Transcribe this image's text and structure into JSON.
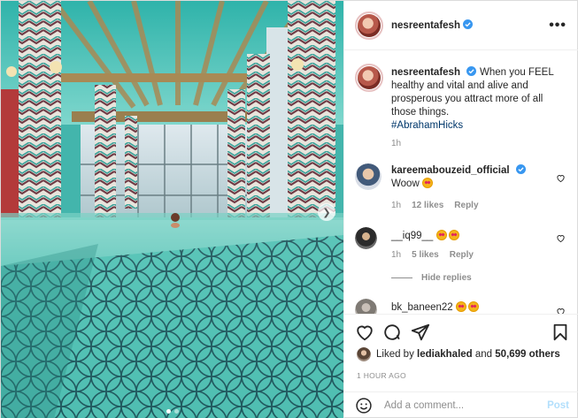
{
  "post": {
    "author": "nesreentafesh",
    "more_label": "•••"
  },
  "caption": {
    "username": "nesreentafesh",
    "text": "When you FEEL healthy and vital and alive and prosperous you attract more of all those things.",
    "hashtag": "#AbrahamHicks",
    "time": "1h"
  },
  "comments": [
    {
      "username": "kareemabouzeid_official",
      "text": "Woow",
      "time": "1h",
      "likes": "12 likes",
      "reply": "Reply"
    },
    {
      "username": "__iq99__",
      "text": "",
      "time": "1h",
      "likes": "5 likes",
      "reply": "Reply"
    },
    {
      "username": "bk_baneen22",
      "text": ""
    }
  ],
  "hide_replies": "Hide replies",
  "likes": {
    "prefix": "Liked by",
    "user": "lediakhaled",
    "mid": "and",
    "others": "50,699 others"
  },
  "time_ago": "1 HOUR AGO",
  "add_comment": {
    "placeholder": "Add a comment...",
    "post_label": "Post"
  },
  "colors": {
    "verified": "#3897f0",
    "link": "#00376b",
    "post_button_disabled": "#b2dffc",
    "pool_water": "#43b5ac"
  },
  "icons": {
    "like": "heart-icon",
    "comment": "comment-icon",
    "share": "paper-plane-icon",
    "save": "bookmark-icon",
    "emoji": "smile-icon",
    "more": "more-options-icon"
  }
}
